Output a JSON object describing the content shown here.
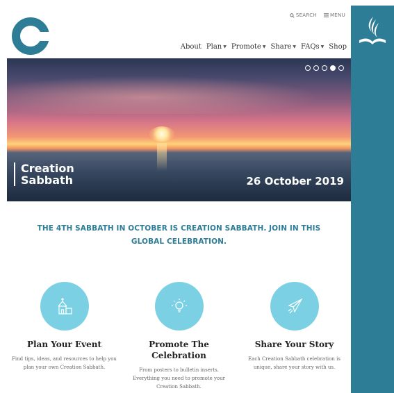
{
  "header": {
    "utility": {
      "search": "SEARCH",
      "menu": "MENU"
    },
    "nav": [
      {
        "label": "About",
        "dropdown": false
      },
      {
        "label": "Plan",
        "dropdown": true
      },
      {
        "label": "Promote",
        "dropdown": true
      },
      {
        "label": "Share",
        "dropdown": true
      },
      {
        "label": "FAQs",
        "dropdown": true
      },
      {
        "label": "Shop",
        "dropdown": false
      }
    ]
  },
  "hero": {
    "title": "Creation Sabbath",
    "date": "26 October 2019",
    "slides_total": 5,
    "active_slide": 4
  },
  "tagline": "THE 4TH SABBATH IN OCTOBER IS CREATION SABBATH. JOIN IN THIS GLOBAL CELEBRATION.",
  "features": [
    {
      "icon": "church-icon",
      "title": "Plan Your Event",
      "text": "Find tips, ideas, and resources to help you plan your own Creation Sabbath."
    },
    {
      "icon": "lightbulb-icon",
      "title": "Promote The Celebration",
      "text": "From posters to bulletin inserts. Everything you need to promote your Creation Sabbath."
    },
    {
      "icon": "paper-plane-icon",
      "title": "Share Your Story",
      "text": "Each Creation Sabbath celebration is unique, share your story with us."
    }
  ],
  "colors": {
    "brand": "#2e7d96",
    "icon_circle": "#7bd1e3"
  }
}
